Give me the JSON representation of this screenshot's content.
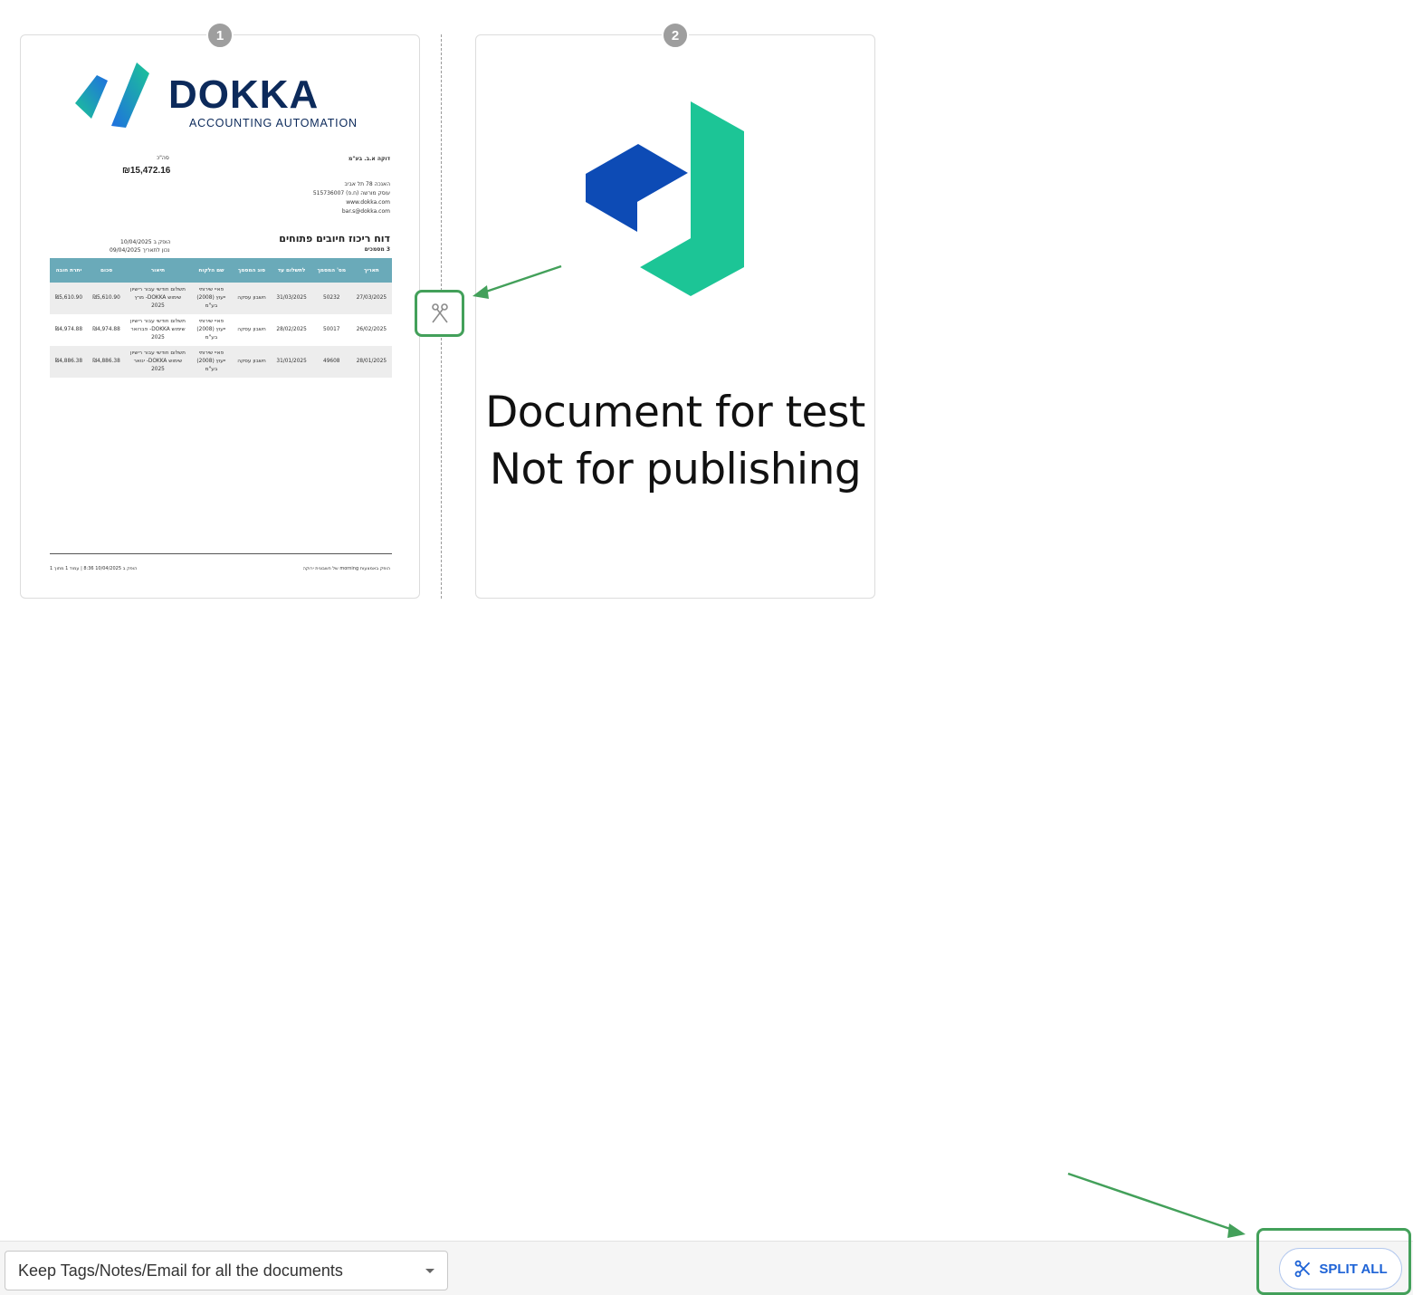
{
  "pages": [
    {
      "number": "1",
      "logo": {
        "wordmark": "DOKKA",
        "tagline": "ACCOUNTING AUTOMATION"
      },
      "company_name": "דוקה א.ב. בע\"מ",
      "address_lines": [
        "האנכה 78 תל אביב",
        "עוסק מורשה (ח.פ) 515736007",
        "www.dokka.com",
        "bar.s@dokka.com"
      ],
      "total_label": "סה\"כ",
      "total_amount": "₪15,472.16",
      "report_title": "דוח ריכוז חיובים פתוחים",
      "report_count": "3 מסמכים",
      "issued": "הופק ב 10/04/2025",
      "valid_until": "נכון לתאריך 09/04/2025",
      "table": {
        "headers": [
          "תאריך",
          "מס' המסמך",
          "לתשלום עד",
          "סוג המסמך",
          "שם הלקוח",
          "תיאור",
          "סכום",
          "יתרת חובה"
        ],
        "rows": [
          [
            "27/03/2025",
            "50232",
            "31/03/2025",
            "חשבון עסקה",
            "פאיי שירותי ייעוץ (2008) בע\"מ",
            "תשלום חודשי עבור רישיון שימוש DOKKA- מרץ 2025",
            "₪5,610.90",
            "₪5,610.90"
          ],
          [
            "26/02/2025",
            "50017",
            "28/02/2025",
            "חשבון עסקה",
            "פאיי שירותי ייעוץ (2008) בע\"מ",
            "תשלום חודשי עבור רישיון שימוש DOKKA- פברואר 2025",
            "₪4,974.88",
            "₪4,974.88"
          ],
          [
            "28/01/2025",
            "49608",
            "31/01/2025",
            "חשבון עסקה",
            "פאיי שירותי ייעוץ (2008) בע\"מ",
            "תשלום חודשי עבור רישיון שימוש DOKKA- ינואר 2025",
            "₪4,886.38",
            "₪4,886.38"
          ]
        ]
      },
      "footer_right": "הופק באמצעות morning של חשבונית ירוקה",
      "footer_left": "הופק ב 10/04/2025 8:36 | עמוד 1 מתוך 1"
    },
    {
      "number": "2",
      "text_line1": "Document for test",
      "text_line2": "Not for publishing"
    }
  ],
  "split_point_icon": "scissors-icon",
  "bottom_bar": {
    "keep_select_value": "Keep Tags/Notes/Email for all the documents",
    "split_all_label": "SPLIT ALL"
  },
  "colors": {
    "accent_green": "#43a05a",
    "button_blue": "#1e63d6",
    "badge_gray": "#9e9e9e",
    "table_header": "#6aaab9",
    "dokka_navy": "#0c2a5b",
    "dokka_green": "#1cc596",
    "dokka_blue": "#0d4bb5"
  }
}
